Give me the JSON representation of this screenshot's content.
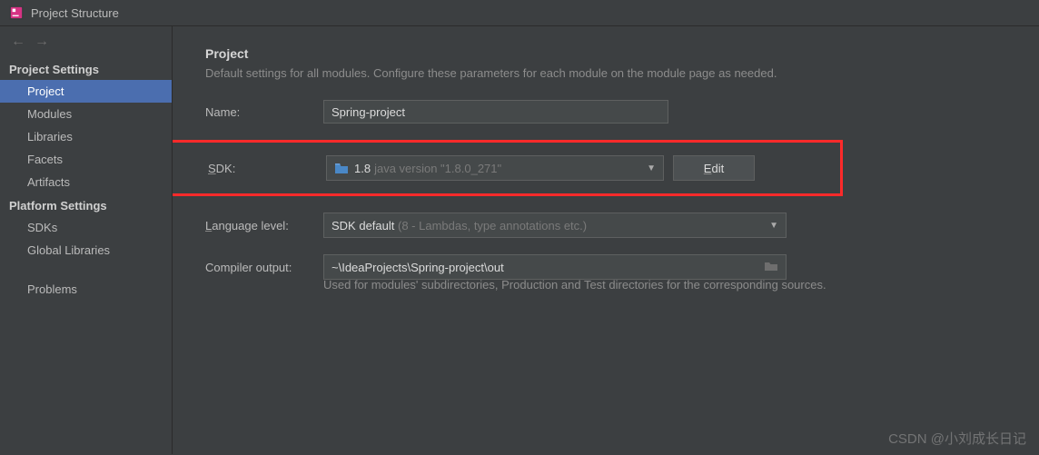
{
  "window": {
    "title": "Project Structure"
  },
  "sidebar": {
    "section1": "Project Settings",
    "items1": [
      {
        "label": "Project"
      },
      {
        "label": "Modules"
      },
      {
        "label": "Libraries"
      },
      {
        "label": "Facets"
      },
      {
        "label": "Artifacts"
      }
    ],
    "section2": "Platform Settings",
    "items2": [
      {
        "label": "SDKs"
      },
      {
        "label": "Global Libraries"
      }
    ],
    "problems": "Problems"
  },
  "main": {
    "title": "Project",
    "subtitle": "Default settings for all modules. Configure these parameters for each module on the module page as needed.",
    "name_label": "Name:",
    "name_value": "Spring-project",
    "sdk_label": "SDK:",
    "sdk_value_main": "1.8",
    "sdk_value_sub": "java version \"1.8.0_271\"",
    "edit_label": "Edit",
    "lang_label": "Language level:",
    "lang_value_main": "SDK default",
    "lang_value_sub": "(8 - Lambdas, type annotations etc.)",
    "output_label": "Compiler output:",
    "output_value": "~\\IdeaProjects\\Spring-project\\out",
    "output_help": "Used for modules' subdirectories, Production and Test directories for the corresponding sources."
  },
  "watermark": "CSDN @小刘成长日记"
}
